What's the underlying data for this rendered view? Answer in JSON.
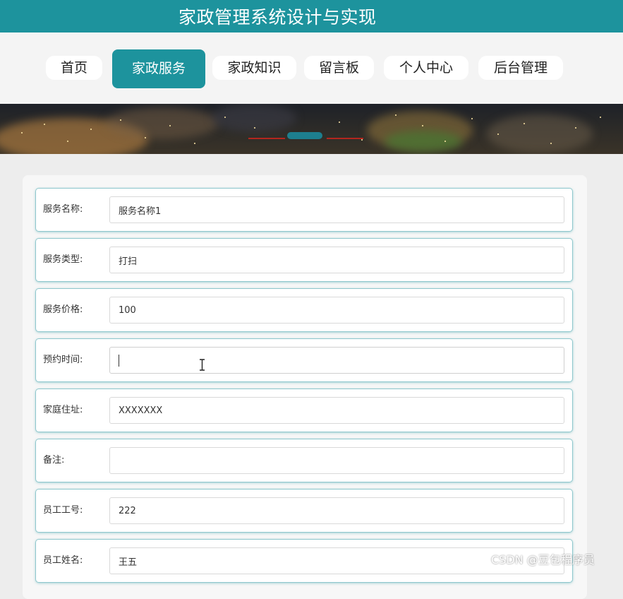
{
  "header": {
    "title": "家政管理系统设计与实现"
  },
  "nav": {
    "items": [
      {
        "label": "首页",
        "active": false
      },
      {
        "label": "家政服务",
        "active": true
      },
      {
        "label": "家政知识",
        "active": false
      },
      {
        "label": "留言板",
        "active": false
      },
      {
        "label": "个人中心",
        "active": false
      },
      {
        "label": "后台管理",
        "active": false
      }
    ]
  },
  "form": {
    "rows": [
      {
        "label": "服务名称:",
        "value": "服务名称1"
      },
      {
        "label": "服务类型:",
        "value": "打扫"
      },
      {
        "label": "服务价格:",
        "value": "100"
      },
      {
        "label": "预约时间:",
        "value": ""
      },
      {
        "label": "家庭住址:",
        "value": "XXXXXXX"
      },
      {
        "label": "备注:",
        "value": ""
      },
      {
        "label": "员工工号:",
        "value": "222"
      },
      {
        "label": "员工姓名:",
        "value": "王五"
      }
    ]
  },
  "watermark": "CSDN @豆包程序员",
  "colors": {
    "accent": "#1d939d",
    "header_text": "#ffffff",
    "page_bg": "#ededed"
  }
}
